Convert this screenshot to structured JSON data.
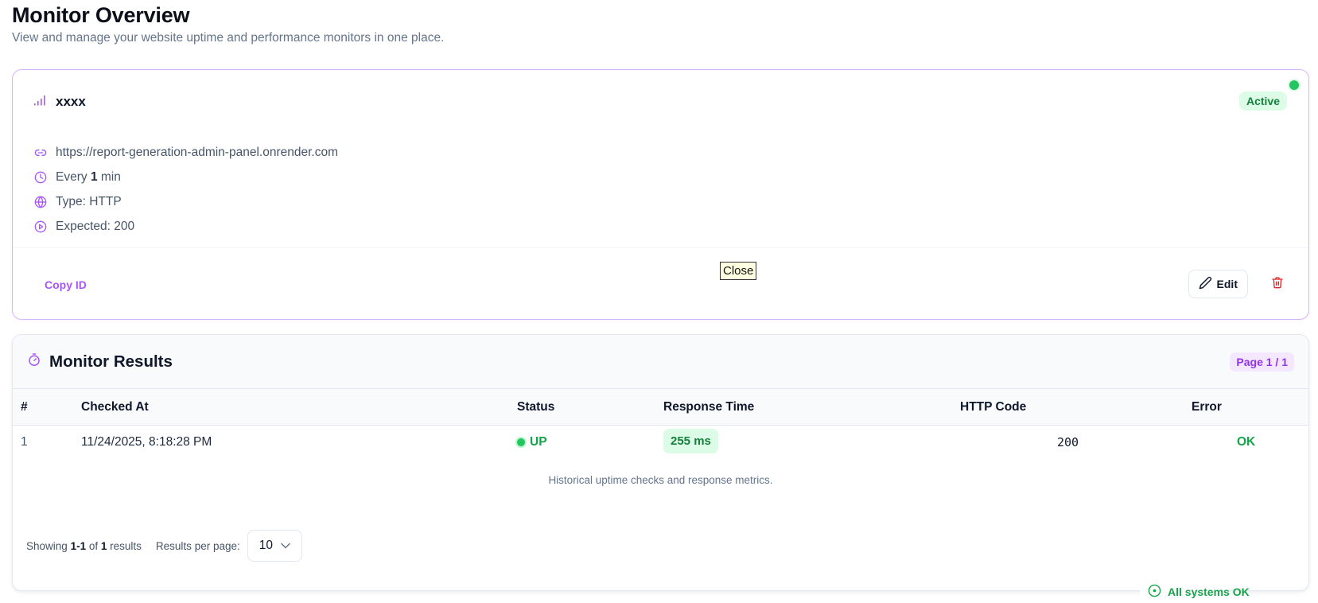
{
  "page": {
    "title": "Monitor Overview",
    "subtitle": "View and manage your website uptime and performance monitors in one place."
  },
  "monitor": {
    "name": "xxxx",
    "status": "Active",
    "url": "https://report-generation-admin-panel.onrender.com",
    "interval_prefix": "Every",
    "interval_value": "1",
    "interval_unit": "min",
    "type": "Type: HTTP",
    "expected": "Expected: 200",
    "copy_id_label": "Copy ID",
    "edit_label": "Edit",
    "tooltip": "Close",
    "icons": [
      "signal-icon",
      "link-icon",
      "clock-icon",
      "globe-icon",
      "play-circle-icon",
      "pencil-icon",
      "trash-icon"
    ]
  },
  "results": {
    "title": "Monitor Results",
    "page_badge": "Page 1 / 1",
    "columns": [
      "#",
      "Checked At",
      "Status",
      "Response Time",
      "HTTP Code",
      "Error"
    ],
    "rows": [
      {
        "index": "1",
        "checked_at": "11/24/2025, 8:18:28 PM",
        "status": "UP",
        "response_time": "255 ms",
        "http_code": "200",
        "error": "OK"
      }
    ],
    "caption": "Historical uptime checks and response metrics.",
    "pager": {
      "showing_prefix": "Showing",
      "range": "1-1",
      "of": "of",
      "total": "1",
      "suffix": "results",
      "per_page_label": "Results per page:",
      "per_page_value": "10"
    }
  },
  "footer": {
    "status": "All systems OK"
  },
  "colors": {
    "accent": "#a855f7",
    "success": "#16a34a",
    "danger": "#dc2626"
  }
}
